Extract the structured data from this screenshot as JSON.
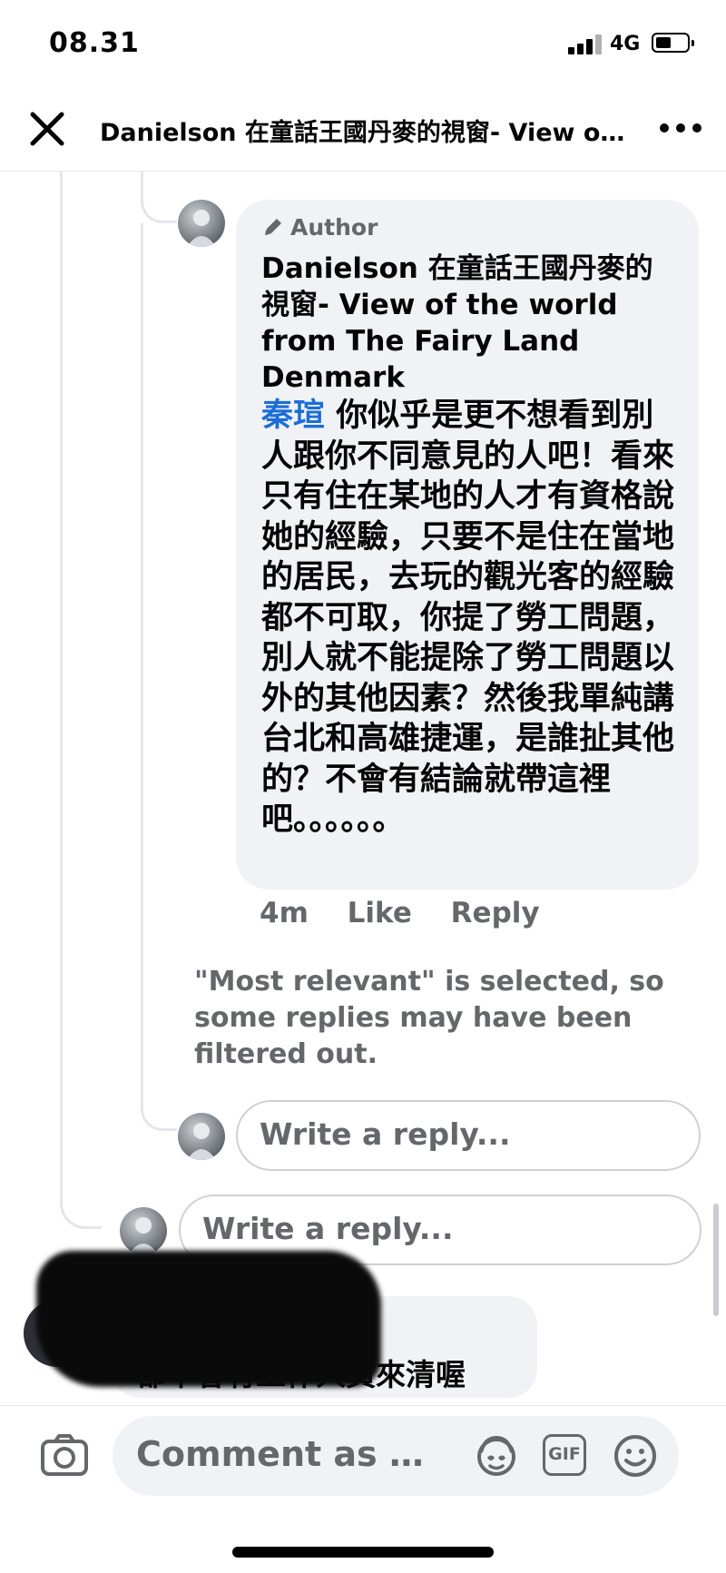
{
  "status_bar": {
    "time": "08.31",
    "network": "4G"
  },
  "header": {
    "title": "Danielson 在童話王國丹麥的視窗- View of the world from The Fairy Land Denmark",
    "close_icon": "close-icon",
    "more_icon": "more-horizontal-icon"
  },
  "comment": {
    "badge_label": "Author",
    "badge_icon": "pencil-icon",
    "author_name": "Danielson 在童話王國丹麥的視窗- View of the world from The Fairy Land Denmark",
    "mention": "秦瑄",
    "body": " 你似乎是更不想看到別人跟你不同意見的人吧！看來只有住在某地的人才有資格說她的經驗，只要不是住在當地的居民，去玩的觀光客的經驗都不可取，你提了勞工問題，別人就不能提除了勞工問題以外的其他因素？然後我單純講台北和高雄捷運，是誰扯其他的？不會有結論就帶這裡吧。。。。。。",
    "time_ago": "4m",
    "like_label": "Like",
    "reply_label": "Reply"
  },
  "filter_note": "\"Most relevant\" is selected, so some replies may have been filtered out.",
  "reply_inner": {
    "placeholder": "Write a reply..."
  },
  "reply_outer": {
    "placeholder": "Write a reply..."
  },
  "other_comment": {
    "text": "都不會有工作人員來清喔"
  },
  "composer": {
    "placeholder": "Comment as Danielson",
    "gif_label": "GIF",
    "icons": [
      "camera-icon",
      "avatar-sticker-icon",
      "gif-icon",
      "emoji-icon"
    ]
  },
  "colors": {
    "mention": "#1b6ed8",
    "secondary_text": "#65676b",
    "bubble": "#f0f2f5"
  }
}
